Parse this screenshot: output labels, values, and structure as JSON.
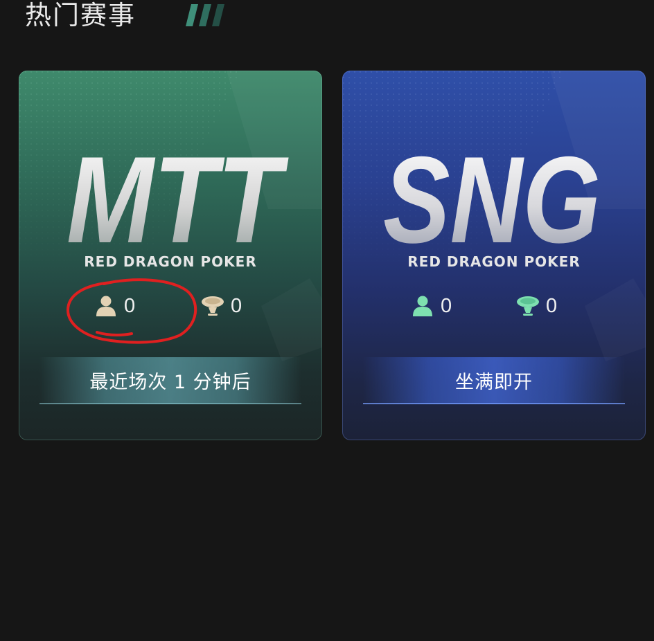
{
  "header": {
    "title": "热门赛事"
  },
  "cards": [
    {
      "logo": "MTT",
      "brand": "RED DRAGON POKER",
      "players_icon": "person-icon",
      "players_count": "0",
      "tables_icon": "poker-table-icon",
      "tables_count": "0",
      "banner": "最近场次 1 分钟后",
      "icon_color": "#e3d2b4"
    },
    {
      "logo": "SNG",
      "brand": "RED DRAGON POKER",
      "players_icon": "person-icon",
      "players_count": "0",
      "tables_icon": "poker-table-icon",
      "tables_count": "0",
      "banner": "坐满即开",
      "icon_color": "#7ee0b0"
    }
  ],
  "colors": {
    "background": "#161616",
    "mtt_card": "#2f6a58",
    "sng_card": "#2a4191",
    "annotation": "#e02020"
  }
}
